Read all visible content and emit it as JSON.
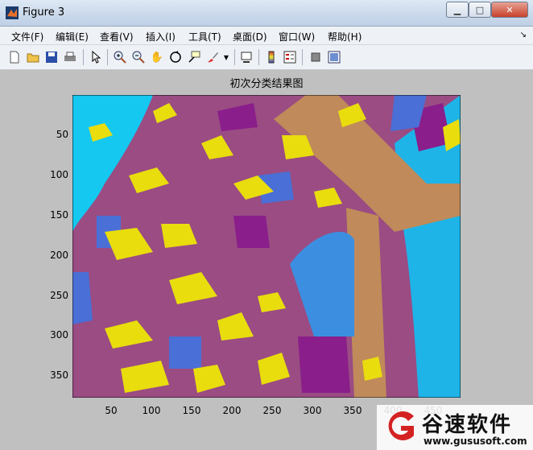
{
  "window": {
    "title": "Figure 3"
  },
  "menu": [
    {
      "label": "文件(F)"
    },
    {
      "label": "编辑(E)"
    },
    {
      "label": "查看(V)"
    },
    {
      "label": "插入(I)"
    },
    {
      "label": "工具(T)"
    },
    {
      "label": "桌面(D)"
    },
    {
      "label": "窗口(W)"
    },
    {
      "label": "帮助(H)"
    }
  ],
  "toolbar": {
    "icons": [
      "new-figure-icon",
      "open-file-icon",
      "save-icon",
      "print-icon",
      "edit-plot-arrow-icon",
      "zoom-in-icon",
      "zoom-out-icon",
      "pan-hand-icon",
      "rotate-3d-icon",
      "data-cursor-icon",
      "brush-icon",
      "brush-dropdown-icon",
      "link-plot-icon",
      "colorbar-icon",
      "legend-icon",
      "hide-plot-tools-icon",
      "show-plot-tools-icon"
    ]
  },
  "plot": {
    "title": "初次分类结果图",
    "y_ticks": [
      "50",
      "100",
      "150",
      "200",
      "250",
      "300",
      "350"
    ],
    "x_ticks": [
      "50",
      "100",
      "150",
      "200",
      "250",
      "300",
      "350",
      "400",
      "450"
    ],
    "image_palette": [
      "#14c8f0",
      "#9a4c83",
      "#e9dd0d",
      "#8a1e8a",
      "#4a6fd6",
      "#c08a5a",
      "#3c8fe0"
    ]
  },
  "watermark": {
    "name": "谷速软件",
    "url": "www.gususoft.com"
  }
}
